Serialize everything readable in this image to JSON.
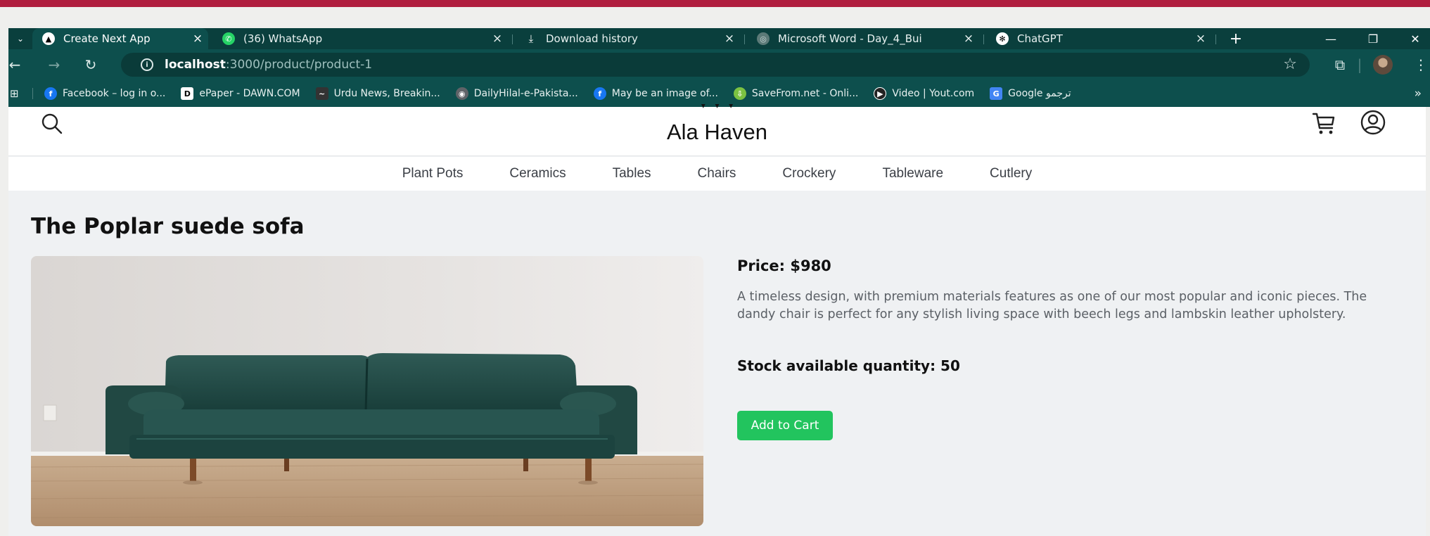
{
  "browser": {
    "tabs": [
      {
        "label": "Create Next App",
        "icon": "nextjs-icon",
        "active": true
      },
      {
        "label": "(36) WhatsApp",
        "icon": "whatsapp-icon",
        "active": false
      },
      {
        "label": "Download history",
        "icon": "download-icon",
        "active": false
      },
      {
        "label": "Microsoft Word - Day_4_Bui",
        "icon": "globe-icon",
        "active": false
      },
      {
        "label": "ChatGPT",
        "icon": "chatgpt-icon",
        "active": false
      }
    ],
    "close_glyph": "×",
    "new_tab_glyph": "+",
    "url_host": "localhost",
    "url_path": ":3000/product/product-1",
    "bookmarks": [
      {
        "label": "Facebook – log in o...",
        "icon": "facebook-icon",
        "color": "#1877f2",
        "glyph": "f"
      },
      {
        "label": "ePaper - DAWN.COM",
        "icon": "dawn-icon",
        "color": "#ffffff",
        "glyph": "D"
      },
      {
        "label": "Urdu News, Breakin...",
        "icon": "urdu-news-icon",
        "color": "#333333",
        "glyph": "~"
      },
      {
        "label": "DailyHilal-e-Pakista...",
        "icon": "globe-icon",
        "color": "#5f6368",
        "glyph": "◉"
      },
      {
        "label": "May be an image of...",
        "icon": "facebook-icon",
        "color": "#1877f2",
        "glyph": "f"
      },
      {
        "label": "SaveFrom.net - Onli...",
        "icon": "savefrom-icon",
        "color": "#7cc242",
        "glyph": "⇩"
      },
      {
        "label": "Video | Yout.com",
        "icon": "video-icon",
        "color": "#222222",
        "glyph": "▶"
      },
      {
        "label": "Google ترجمو",
        "icon": "google-translate-icon",
        "color": "#4285f4",
        "glyph": "G"
      }
    ],
    "bookmarks_more": "»"
  },
  "site": {
    "brand": "Ala Haven",
    "categories": [
      "Plant Pots",
      "Ceramics",
      "Tables",
      "Chairs",
      "Crockery",
      "Tableware",
      "Cutlery"
    ]
  },
  "product": {
    "title": "The Poplar suede sofa",
    "price": "Price: $980",
    "description": "A timeless design, with premium materials features as one of our most popular and iconic pieces. The dandy chair is perfect for any stylish living space with beech legs and lambskin leather upholstery.",
    "stock": "Stock available quantity: 50",
    "add_to_cart": "Add to Cart",
    "image": "green-velvet-sofa"
  },
  "colors": {
    "accent_top": "#b01e3f",
    "browser": "#0d4f4d",
    "button": "#22c45e"
  }
}
